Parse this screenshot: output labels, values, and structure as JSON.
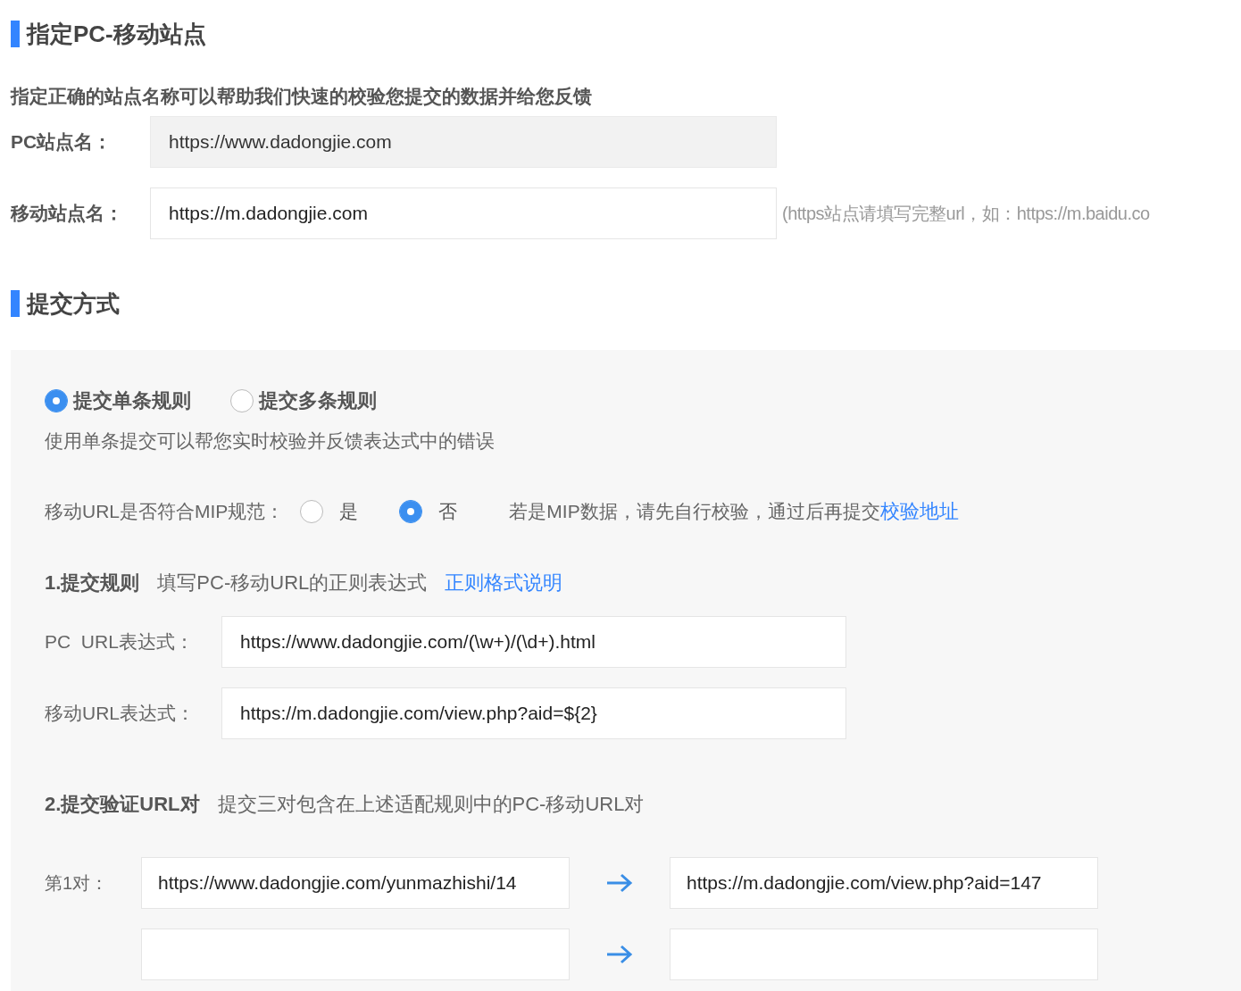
{
  "site_section": {
    "title": "指定PC-移动站点",
    "intro": "指定正确的站点名称可以帮助我们快速的校验您提交的数据并给您反馈",
    "fields": [
      {
        "label": "PC站点名：",
        "value": "https://www.dadongjie.com",
        "disabled": true
      },
      {
        "label": "移动站点名：",
        "value": "https://m.dadongjie.com",
        "disabled": false,
        "hint": "(https站点请填写完整url，如：https://m.baidu.co"
      }
    ]
  },
  "submit_section": {
    "title": "提交方式",
    "modes": [
      {
        "label": "提交单条规则",
        "selected": true
      },
      {
        "label": "提交多条规则",
        "selected": false
      }
    ],
    "mode_note": "使用单条提交可以帮您实时校验并反馈表达式中的错误",
    "mip": {
      "label": "移动URL是否符合MIP规范：",
      "options": [
        {
          "label": "是",
          "selected": false
        },
        {
          "label": "否",
          "selected": true
        }
      ],
      "note": "若是MIP数据，请先自行校验，通过后再提交",
      "link": "校验地址"
    },
    "rules": {
      "title": "1.提交规则",
      "desc": "填写PC-移动URL的正则表达式",
      "link": "正则格式说明",
      "fields": [
        {
          "label": "PC  URL表达式：",
          "value": "https://www.dadongjie.com/(\\w+)/(\\d+).html"
        },
        {
          "label": "移动URL表达式：",
          "value": "https://m.dadongjie.com/view.php?aid=${2}"
        }
      ]
    },
    "pairs": {
      "title": "2.提交验证URL对",
      "desc": "提交三对包含在上述适配规则中的PC-移动URL对",
      "rows": [
        {
          "label": "第1对：",
          "pc": "https://www.dadongjie.com/yunmazhishi/14",
          "mobile": "https://m.dadongjie.com/view.php?aid=147"
        },
        {}
      ]
    }
  }
}
